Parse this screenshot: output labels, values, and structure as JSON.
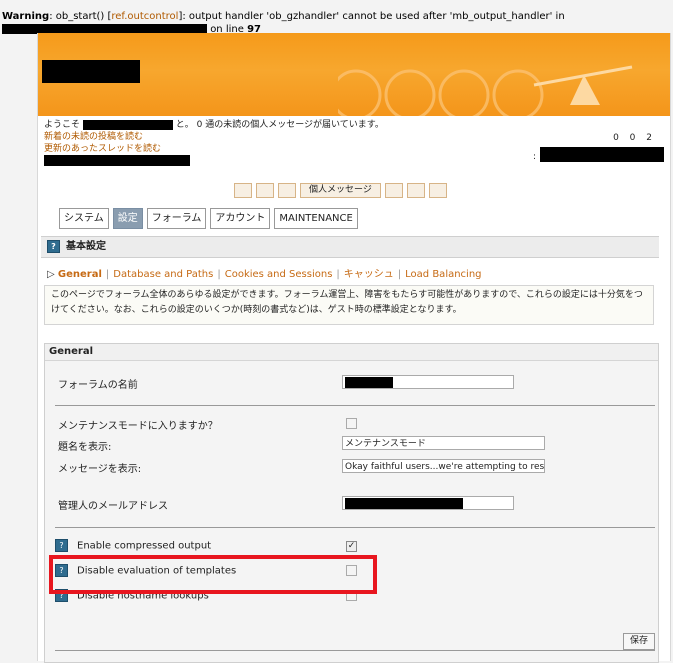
{
  "warning": {
    "label": "Warning",
    "text_before": ": ob_start() [",
    "link": "ref.outcontrol",
    "text_after": "]: output handler 'ob_gzhandler' cannot be used after 'mb_output_handler' in",
    "line_text": "on line",
    "line_no": "97"
  },
  "welcome": {
    "prefix": "ようこそ",
    "suffix": "と。 0 通の未読の個人メッセージが届いています。",
    "link_new": "新着の未読の投稿を読む",
    "link_updated": "更新のあったスレッドを読む",
    "right_count": "0 0 2"
  },
  "topnav": {
    "pm_label": "個人メッセージ"
  },
  "tabs": [
    "システム",
    "設定",
    "フォーラム",
    "アカウント",
    "MAINTENANCE"
  ],
  "section": {
    "title": "基本設定"
  },
  "subnav": [
    "General",
    "Database and Paths",
    "Cookies and Sessions",
    "キャッシュ",
    "Load Balancing"
  ],
  "info_text": "このページでフォーラム全体のあらゆる設定ができます。フォーラム運営上、障害をもたらす可能性がありますので、これらの設定には十分気をつけてください。なお、これらの設定のいくつか(時刻の書式など)は、ゲスト時の標準設定となります。",
  "settings": {
    "title": "General",
    "forum_name_label": "フォーラムの名前",
    "maintenance_label": "メンテナンスモードに入りますか？",
    "subject_label": "題名を表示:",
    "subject_value": "メンテナンスモード",
    "message_label": "メッセージを表示:",
    "message_value": "Okay faithful users...we're attempting to restor",
    "admin_email_label": "管理人のメールアドレス",
    "compress_label": "Enable compressed output",
    "compress_checked": true,
    "templates_label": "Disable evaluation of templates",
    "hostname_label": "Disable hostname lookups",
    "save_label": "保存"
  }
}
